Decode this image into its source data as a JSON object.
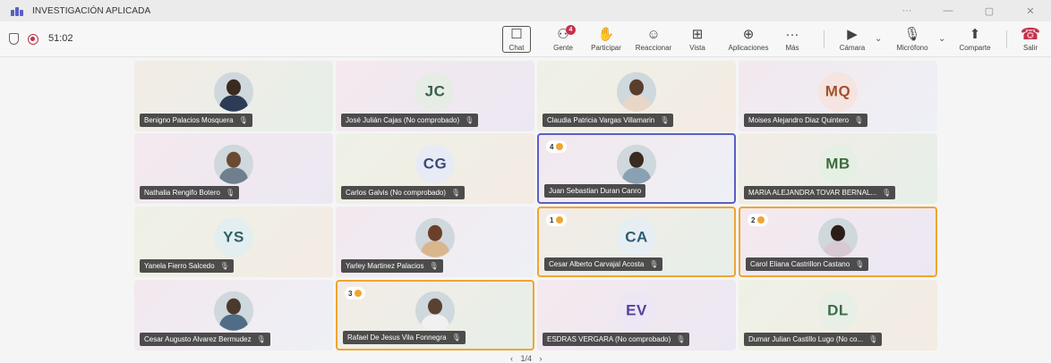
{
  "window": {
    "title": "INVESTIGACIÓN APLICADA",
    "controls": [
      "···",
      "—",
      "▢",
      "✕"
    ]
  },
  "meeting": {
    "timer": "51:02"
  },
  "toolbar": {
    "chat": "Chat",
    "people": "Gente",
    "people_badge": "4",
    "raise": "Participar",
    "react": "Reaccionar",
    "view": "Vista",
    "apps": "Aplicaciones",
    "more": "Más",
    "camera": "Cámara",
    "mic": "Micrófono",
    "share": "Comparte",
    "leave": "Salir"
  },
  "colors": {
    "accent": "#5b5fc7",
    "hand": "#f0a530",
    "leave": "#c4314b"
  },
  "participants": [
    {
      "name": "Benigno Palacios Mosquera",
      "type": "photo"
    },
    {
      "name": "José Julián Cajas (No comprobado)",
      "initials": "JC"
    },
    {
      "name": "Claudia Patricia Vargas Villamarin",
      "type": "photo"
    },
    {
      "name": "Moises Alejandro Diaz Quintero",
      "initials": "MQ"
    },
    {
      "name": "Nathalia Rengifo Botero",
      "type": "photo"
    },
    {
      "name": "Carlos Galvis (No comprobado)",
      "initials": "CG"
    },
    {
      "name": "Juan Sebastian Duran Canro",
      "type": "photo",
      "hand": "4"
    },
    {
      "name": "MARIA ALEJANDRA TOVAR BERNAL...",
      "initials": "MB"
    },
    {
      "name": "Yanela Fierro Salcedo",
      "initials": "YS"
    },
    {
      "name": "Yarley Martinez Palacios",
      "type": "photo"
    },
    {
      "name": "Cesar Alberto Carvajal Acosta",
      "initials": "CA",
      "hand": "1"
    },
    {
      "name": "Carol Eliana Castrillon Castano",
      "type": "photo",
      "hand": "2"
    },
    {
      "name": "Cesar Augusto Alvarez Bermudez",
      "type": "photo"
    },
    {
      "name": "Rafael De Jesus Vila Fonnegra",
      "type": "photo",
      "hand": "3"
    },
    {
      "name": "ESDRAS VERGARA (No comprobado)",
      "initials": "EV"
    },
    {
      "name": "Dumar Julian Castillo Lugo (No co...",
      "initials": "DL"
    }
  ],
  "pager": {
    "text": "1/4"
  }
}
